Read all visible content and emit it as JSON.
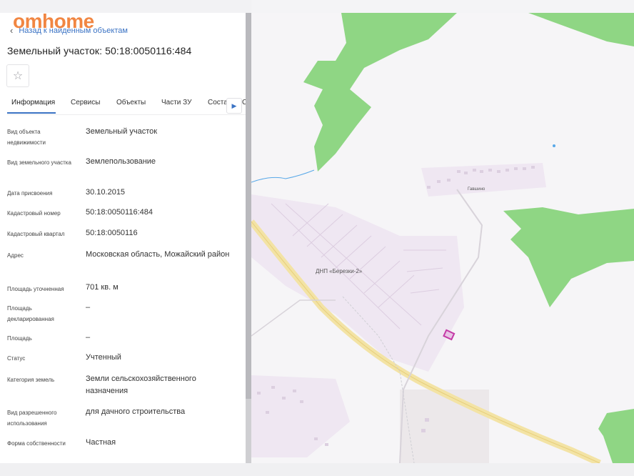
{
  "brand": {
    "logo": "omhome"
  },
  "panel": {
    "back_label": "Назад к найденным объектам",
    "title": "Земельный участок: 50:18:0050116:484",
    "tabs": [
      "Информация",
      "Сервисы",
      "Объекты",
      "Части ЗУ",
      "Соста"
    ],
    "tab_more": "С",
    "rows": [
      {
        "label": "Вид объекта недвижимости",
        "value": "Земельный участок"
      },
      {
        "label": "Вид земельного участка",
        "value": "Землепользование"
      },
      {
        "label": "Дата присвоения",
        "value": "30.10.2015"
      },
      {
        "label": "Кадастровый номер",
        "value": "50:18:0050116:484"
      },
      {
        "label": "Кадастровый квартал",
        "value": "50:18:0050116"
      },
      {
        "label": "Адрес",
        "value": "Московская область, Можайский район"
      },
      {
        "label": "Площадь уточненная",
        "value": "701 кв. м"
      },
      {
        "label": "Площадь декларированная",
        "value": "–"
      },
      {
        "label": "Площадь",
        "value": "–"
      },
      {
        "label": "Статус",
        "value": "Учтенный"
      },
      {
        "label": "Категория земель",
        "value": "Земли сельскохозяйственного назначения"
      },
      {
        "label": "Вид разрешенного использования",
        "value": "для дачного строительства"
      },
      {
        "label": "Форма собственности",
        "value": "Частная"
      }
    ]
  },
  "map": {
    "labels": {
      "snt": "ДНП «Березки-2»",
      "village": "Гавшино"
    },
    "colors": {
      "forest": "#8fd684",
      "road": "#f3e3a5",
      "settlement": "#ece4ef",
      "parcel": "#c43aa6",
      "water": "#58a8e8"
    }
  }
}
